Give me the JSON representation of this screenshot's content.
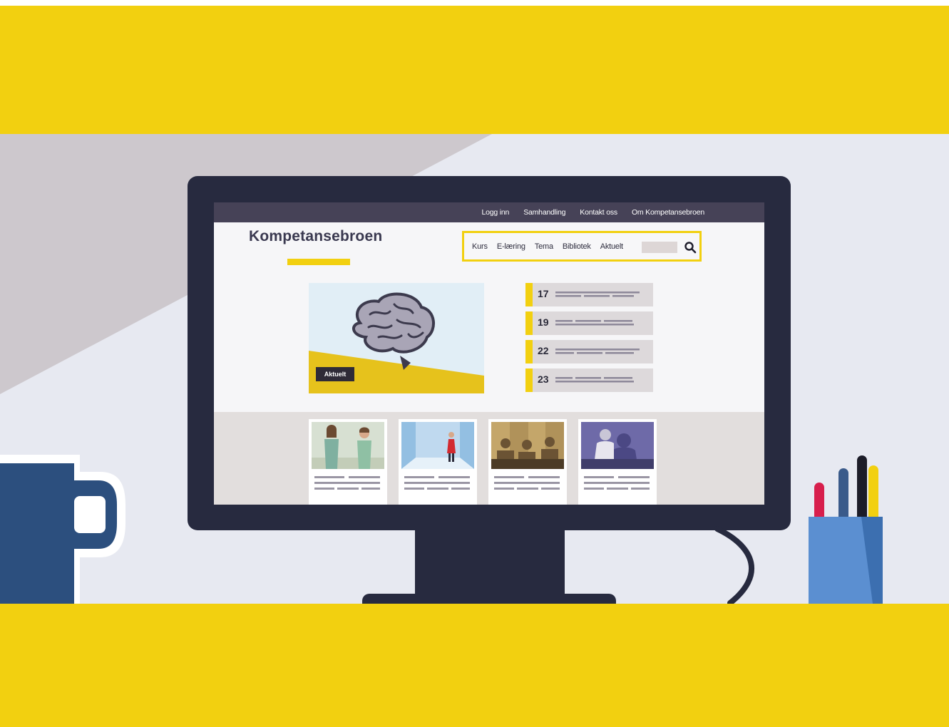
{
  "site": {
    "logo": "Kompetansebroen",
    "top_nav": [
      "Logg inn",
      "Samhandling",
      "Kontakt oss",
      "Om Kompetansebroen"
    ],
    "main_nav": [
      "Kurs",
      "E-læring",
      "Tema",
      "Bibliotek",
      "Aktuelt"
    ],
    "hero_badge": "Aktuelt",
    "events": [
      {
        "day": "17"
      },
      {
        "day": "19"
      },
      {
        "day": "22"
      },
      {
        "day": "23"
      }
    ]
  },
  "colors": {
    "accent_yellow": "#f2d010",
    "monitor_dark": "#272a3f",
    "topbar": "#464257",
    "mug_blue": "#2c4f7e",
    "pencil_cup": "#5b8fd1"
  },
  "icons": [
    "search-icon",
    "brain-icon",
    "mug-icon",
    "pencil-cup-icon"
  ]
}
